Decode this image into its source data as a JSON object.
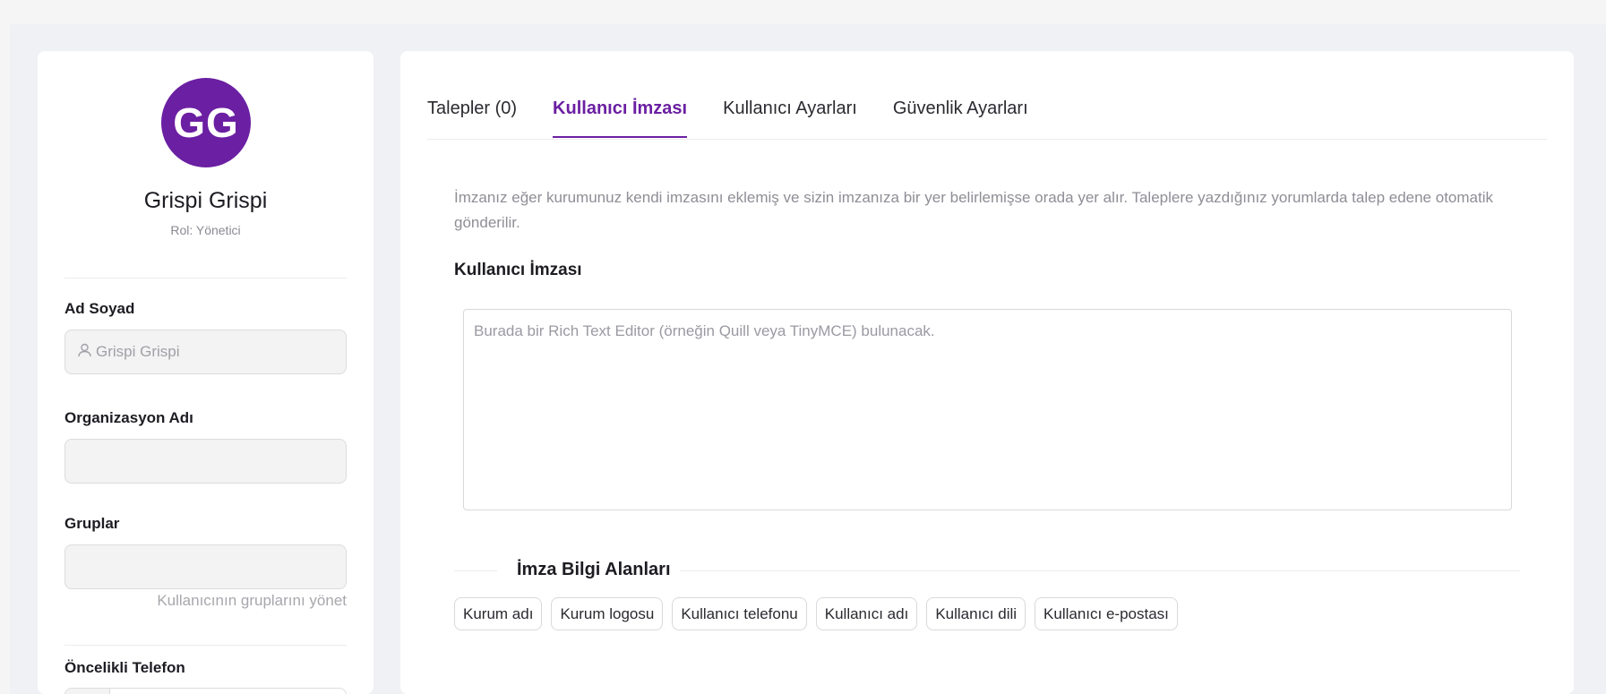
{
  "profile": {
    "initials": "GG",
    "name": "Grispi Grispi",
    "role": "Rol: Yönetici",
    "avatar_color": "#6b1fa2"
  },
  "fields": {
    "full_name_label": "Ad Soyad",
    "full_name_value": "Grispi Grispi",
    "organization_label": "Organizasyon Adı",
    "organization_value": "",
    "groups_label": "Gruplar",
    "groups_value": "",
    "groups_manage_link": "Kullanıcının gruplarını yönet",
    "phone_label": "Öncelikli Telefon"
  },
  "tabs": [
    {
      "label": "Talepler (0)",
      "active": false
    },
    {
      "label": "Kullanıcı İmzası",
      "active": true
    },
    {
      "label": "Kullanıcı Ayarları",
      "active": false
    },
    {
      "label": "Güvenlik Ayarları",
      "active": false
    }
  ],
  "signature": {
    "description": "İmzanız eğer kurumunuz kendi imzasını eklemiş ve sizin imzanıza bir yer belirlemişse orada yer alır. Taleplere yazdığınız yorumlarda talep edene otomatik gönderilir.",
    "title": "Kullanıcı İmzası",
    "editor_placeholder": "Burada bir Rich Text Editor (örneğin Quill veya TinyMCE) bulunacak.",
    "fields_title": "İmza Bilgi Alanları",
    "chips": [
      "Kurum adı",
      "Kurum logosu",
      "Kullanıcı telefonu",
      "Kullanıcı adı",
      "Kullanıcı dili",
      "Kullanıcı e-postası"
    ]
  },
  "colors": {
    "accent": "#6b1fa2",
    "background": "#f0f1f4"
  }
}
